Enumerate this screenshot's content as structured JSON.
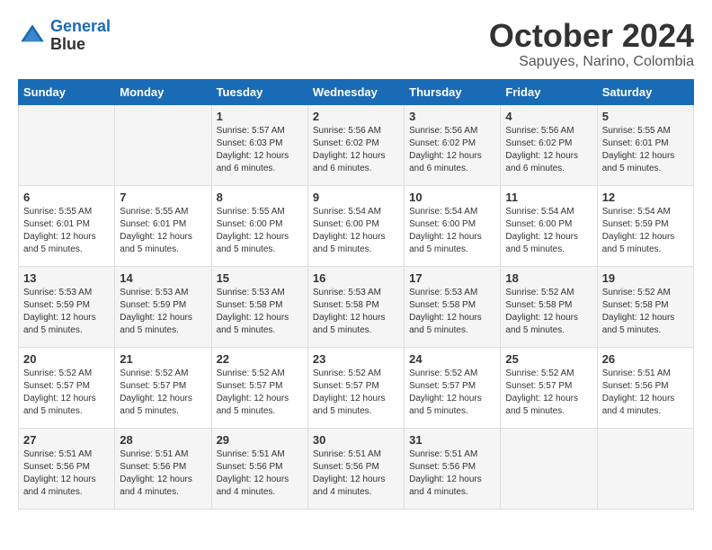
{
  "header": {
    "logo_line1": "General",
    "logo_line2": "Blue",
    "month": "October 2024",
    "location": "Sapuyes, Narino, Colombia"
  },
  "days_of_week": [
    "Sunday",
    "Monday",
    "Tuesday",
    "Wednesday",
    "Thursday",
    "Friday",
    "Saturday"
  ],
  "weeks": [
    [
      {
        "day": "",
        "info": ""
      },
      {
        "day": "",
        "info": ""
      },
      {
        "day": "1",
        "info": "Sunrise: 5:57 AM\nSunset: 6:03 PM\nDaylight: 12 hours\nand 6 minutes."
      },
      {
        "day": "2",
        "info": "Sunrise: 5:56 AM\nSunset: 6:02 PM\nDaylight: 12 hours\nand 6 minutes."
      },
      {
        "day": "3",
        "info": "Sunrise: 5:56 AM\nSunset: 6:02 PM\nDaylight: 12 hours\nand 6 minutes."
      },
      {
        "day": "4",
        "info": "Sunrise: 5:56 AM\nSunset: 6:02 PM\nDaylight: 12 hours\nand 6 minutes."
      },
      {
        "day": "5",
        "info": "Sunrise: 5:55 AM\nSunset: 6:01 PM\nDaylight: 12 hours\nand 5 minutes."
      }
    ],
    [
      {
        "day": "6",
        "info": "Sunrise: 5:55 AM\nSunset: 6:01 PM\nDaylight: 12 hours\nand 5 minutes."
      },
      {
        "day": "7",
        "info": "Sunrise: 5:55 AM\nSunset: 6:01 PM\nDaylight: 12 hours\nand 5 minutes."
      },
      {
        "day": "8",
        "info": "Sunrise: 5:55 AM\nSunset: 6:00 PM\nDaylight: 12 hours\nand 5 minutes."
      },
      {
        "day": "9",
        "info": "Sunrise: 5:54 AM\nSunset: 6:00 PM\nDaylight: 12 hours\nand 5 minutes."
      },
      {
        "day": "10",
        "info": "Sunrise: 5:54 AM\nSunset: 6:00 PM\nDaylight: 12 hours\nand 5 minutes."
      },
      {
        "day": "11",
        "info": "Sunrise: 5:54 AM\nSunset: 6:00 PM\nDaylight: 12 hours\nand 5 minutes."
      },
      {
        "day": "12",
        "info": "Sunrise: 5:54 AM\nSunset: 5:59 PM\nDaylight: 12 hours\nand 5 minutes."
      }
    ],
    [
      {
        "day": "13",
        "info": "Sunrise: 5:53 AM\nSunset: 5:59 PM\nDaylight: 12 hours\nand 5 minutes."
      },
      {
        "day": "14",
        "info": "Sunrise: 5:53 AM\nSunset: 5:59 PM\nDaylight: 12 hours\nand 5 minutes."
      },
      {
        "day": "15",
        "info": "Sunrise: 5:53 AM\nSunset: 5:58 PM\nDaylight: 12 hours\nand 5 minutes."
      },
      {
        "day": "16",
        "info": "Sunrise: 5:53 AM\nSunset: 5:58 PM\nDaylight: 12 hours\nand 5 minutes."
      },
      {
        "day": "17",
        "info": "Sunrise: 5:53 AM\nSunset: 5:58 PM\nDaylight: 12 hours\nand 5 minutes."
      },
      {
        "day": "18",
        "info": "Sunrise: 5:52 AM\nSunset: 5:58 PM\nDaylight: 12 hours\nand 5 minutes."
      },
      {
        "day": "19",
        "info": "Sunrise: 5:52 AM\nSunset: 5:58 PM\nDaylight: 12 hours\nand 5 minutes."
      }
    ],
    [
      {
        "day": "20",
        "info": "Sunrise: 5:52 AM\nSunset: 5:57 PM\nDaylight: 12 hours\nand 5 minutes."
      },
      {
        "day": "21",
        "info": "Sunrise: 5:52 AM\nSunset: 5:57 PM\nDaylight: 12 hours\nand 5 minutes."
      },
      {
        "day": "22",
        "info": "Sunrise: 5:52 AM\nSunset: 5:57 PM\nDaylight: 12 hours\nand 5 minutes."
      },
      {
        "day": "23",
        "info": "Sunrise: 5:52 AM\nSunset: 5:57 PM\nDaylight: 12 hours\nand 5 minutes."
      },
      {
        "day": "24",
        "info": "Sunrise: 5:52 AM\nSunset: 5:57 PM\nDaylight: 12 hours\nand 5 minutes."
      },
      {
        "day": "25",
        "info": "Sunrise: 5:52 AM\nSunset: 5:57 PM\nDaylight: 12 hours\nand 5 minutes."
      },
      {
        "day": "26",
        "info": "Sunrise: 5:51 AM\nSunset: 5:56 PM\nDaylight: 12 hours\nand 4 minutes."
      }
    ],
    [
      {
        "day": "27",
        "info": "Sunrise: 5:51 AM\nSunset: 5:56 PM\nDaylight: 12 hours\nand 4 minutes."
      },
      {
        "day": "28",
        "info": "Sunrise: 5:51 AM\nSunset: 5:56 PM\nDaylight: 12 hours\nand 4 minutes."
      },
      {
        "day": "29",
        "info": "Sunrise: 5:51 AM\nSunset: 5:56 PM\nDaylight: 12 hours\nand 4 minutes."
      },
      {
        "day": "30",
        "info": "Sunrise: 5:51 AM\nSunset: 5:56 PM\nDaylight: 12 hours\nand 4 minutes."
      },
      {
        "day": "31",
        "info": "Sunrise: 5:51 AM\nSunset: 5:56 PM\nDaylight: 12 hours\nand 4 minutes."
      },
      {
        "day": "",
        "info": ""
      },
      {
        "day": "",
        "info": ""
      }
    ]
  ]
}
